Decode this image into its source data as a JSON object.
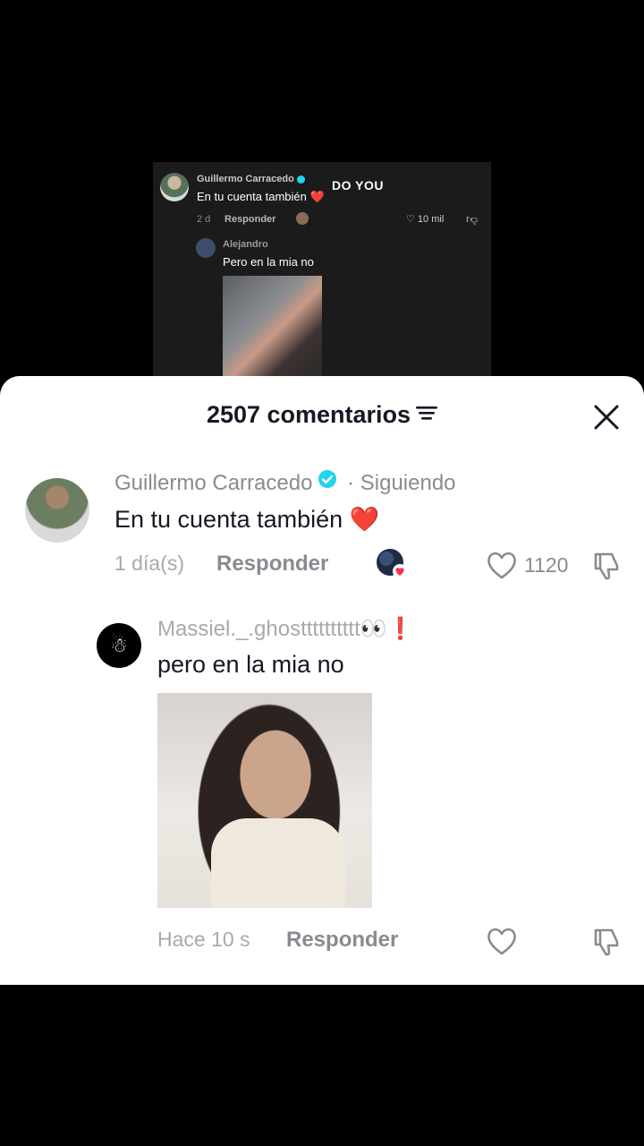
{
  "video": {
    "overlay_text": "DO YOU",
    "comment": {
      "author": "Guillermo Carracedo",
      "text": "En tu cuenta también",
      "heart": "❤️",
      "time": "2 d",
      "reply_label": "Responder",
      "likes": "10 mil"
    },
    "reply": {
      "author": "Alejandro",
      "text": "Pero en la mia no"
    }
  },
  "sheet": {
    "title": "2507 comentarios"
  },
  "comments": [
    {
      "author": "Guillermo Carracedo",
      "separator": " · ",
      "relation": "Siguiendo",
      "text": "En tu cuenta también",
      "heart": "❤️",
      "time": "1 día(s)",
      "reply_label": "Responder",
      "likes": "1120"
    },
    {
      "author": "Massiel._.ghostttttttttt",
      "eyes": "👀",
      "mark": "❗",
      "text": "pero en la mia no",
      "time": "Hace 10 s",
      "reply_label": "Responder"
    }
  ],
  "colors": {
    "verified": "#20d5ec",
    "heart": "#e8223a",
    "text": "#161823",
    "muted": "#8a8b91"
  }
}
